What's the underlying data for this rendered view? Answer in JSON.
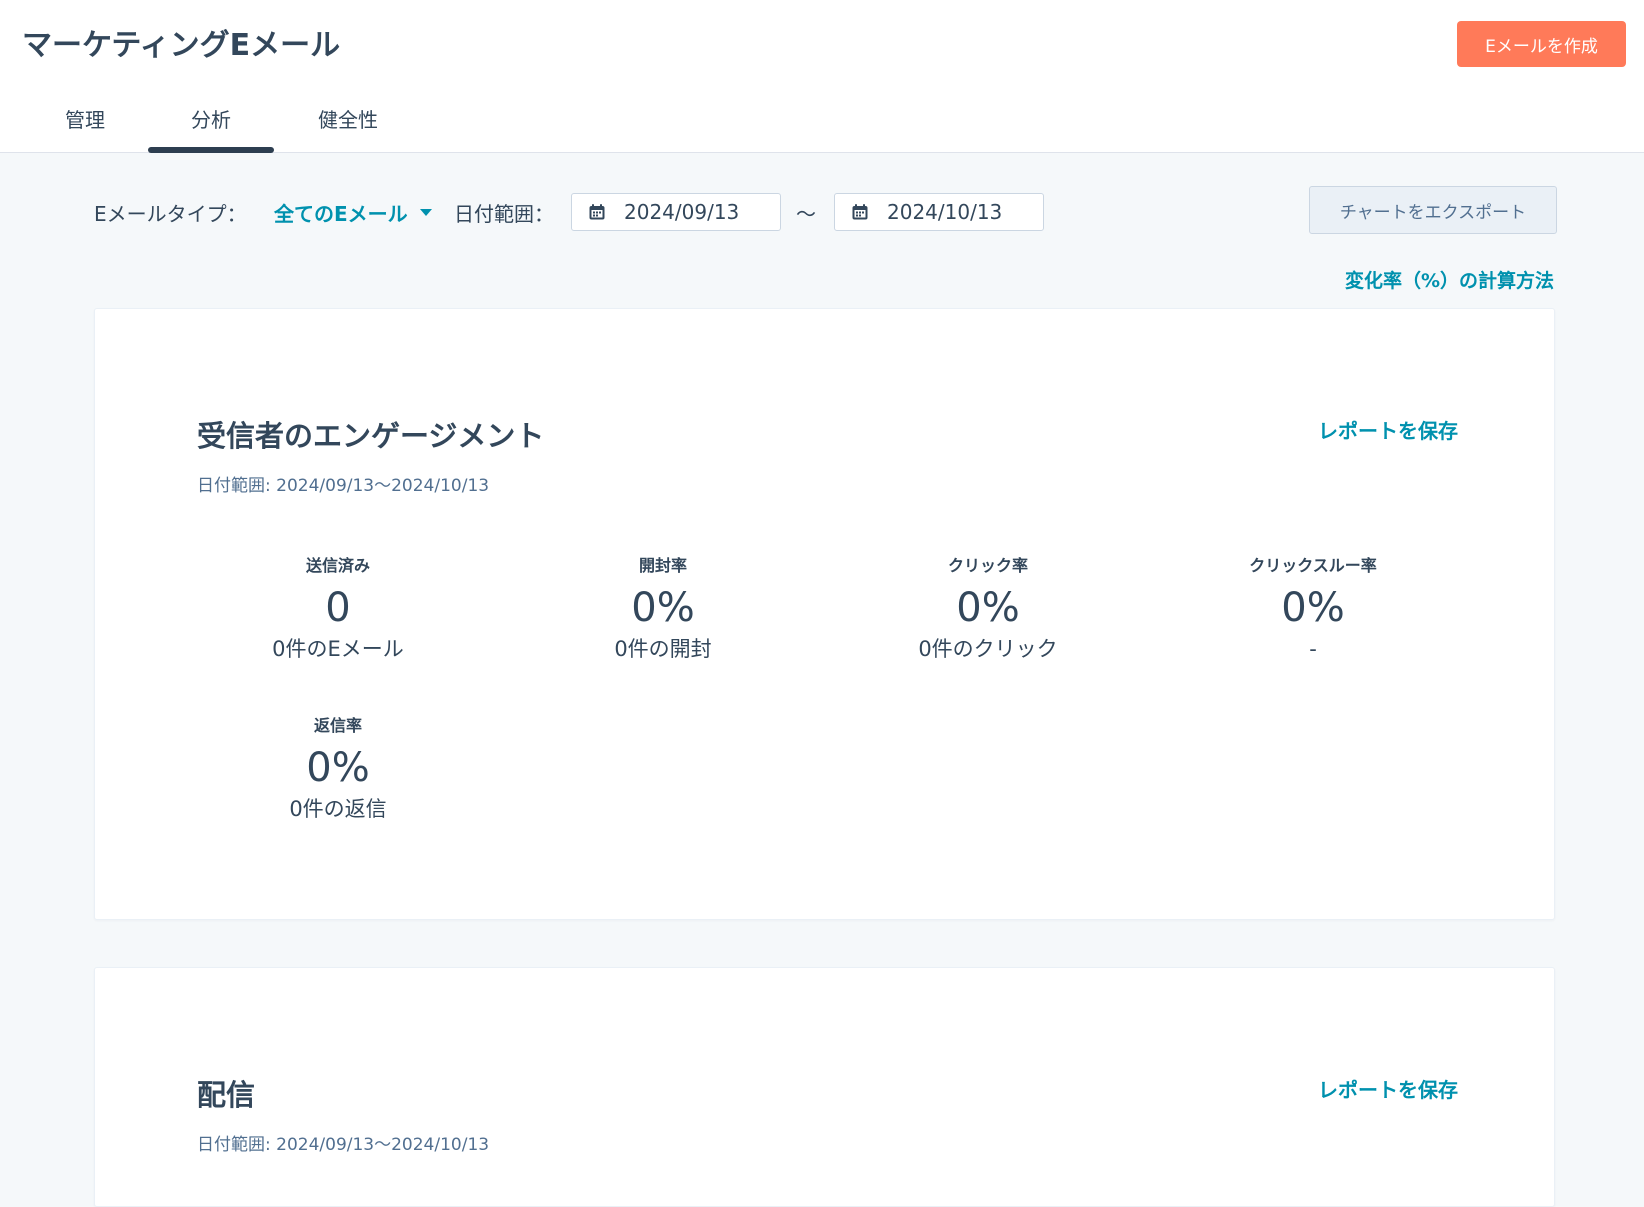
{
  "header": {
    "title": "マーケティングEメール",
    "create_button": "Eメールを作成",
    "tabs": [
      {
        "label": "管理",
        "active": false
      },
      {
        "label": "分析",
        "active": true
      },
      {
        "label": "健全性",
        "active": false
      }
    ]
  },
  "filters": {
    "email_type_label": "Eメールタイプ：",
    "email_type_value": "全てのEメール",
    "date_range_label": "日付範囲：",
    "start_date": "2024/09/13",
    "separator": "〜",
    "end_date": "2024/10/13",
    "export_button": "チャートをエクスポート",
    "calc_link": "変化率（%）の計算方法"
  },
  "cards": [
    {
      "title": "受信者のエンゲージメント",
      "date_range": "日付範囲: 2024/09/13〜2024/10/13",
      "save_link": "レポートを保存",
      "metrics": [
        {
          "label": "送信済み",
          "value": "0",
          "sub": "0件のEメール"
        },
        {
          "label": "開封率",
          "value": "0%",
          "sub": "0件の開封"
        },
        {
          "label": "クリック率",
          "value": "0%",
          "sub": "0件のクリック"
        },
        {
          "label": "クリックスルー率",
          "value": "0%",
          "sub": "-"
        },
        {
          "label": "返信率",
          "value": "0%",
          "sub": "0件の返信"
        }
      ]
    },
    {
      "title": "配信",
      "date_range": "日付範囲: 2024/09/13〜2024/10/13",
      "save_link": "レポートを保存"
    }
  ],
  "colors": {
    "accent": "#0091ae",
    "primary_button": "#ff7a59",
    "text": "#33475b",
    "background": "#f5f8fa"
  },
  "icons": {
    "date_input": "calendar-icon",
    "dropdown": "chevron-down-icon"
  }
}
